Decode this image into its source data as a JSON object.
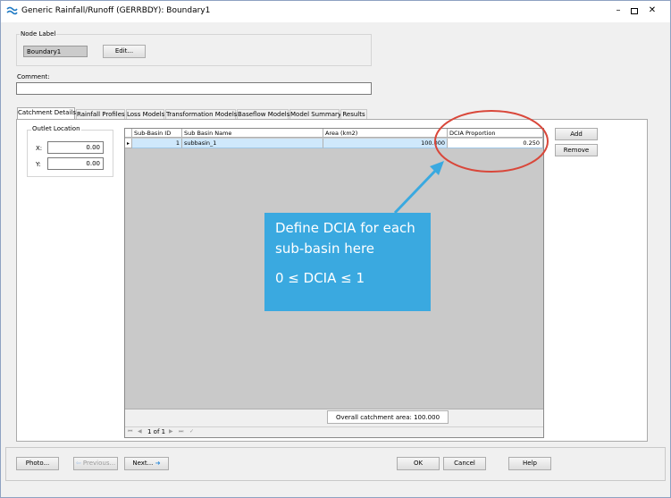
{
  "window": {
    "title": "Generic Rainfall/Runoff (GERRBDY): Boundary1",
    "controls": [
      "minimize",
      "maximize",
      "close"
    ]
  },
  "node_label": {
    "group_label": "Node Label",
    "value": "Boundary1",
    "edit_button": "Edit..."
  },
  "comment": {
    "label": "Comment:",
    "value": ""
  },
  "tabs": [
    {
      "label": "Catchment Details",
      "active": true
    },
    {
      "label": "Rainfall Profiles",
      "active": false
    },
    {
      "label": "Loss Models",
      "active": false
    },
    {
      "label": "Transformation Models",
      "active": false
    },
    {
      "label": "Baseflow Models",
      "active": false
    },
    {
      "label": "Model Summary",
      "active": false
    },
    {
      "label": "Results",
      "active": false
    }
  ],
  "outlet_location": {
    "group_label": "Outlet Location",
    "x_label": "X:",
    "x_value": "0.00",
    "y_label": "Y:",
    "y_value": "0.00"
  },
  "grid": {
    "columns": [
      "Sub-Basin ID",
      "Sub Basin Name",
      "Area (km2)",
      "DCIA Proportion"
    ],
    "rows": [
      {
        "marker": "▸",
        "id": "1",
        "name": "subbasin_1",
        "area": "100.000",
        "dcia": "0.250"
      }
    ],
    "overall_area_text": "Overall catchment area: 100.000"
  },
  "grid_buttons": {
    "add": "Add",
    "remove": "Remove"
  },
  "pager": {
    "first": "⏮",
    "prev": "◀",
    "text": "1 of 1",
    "next": "▶",
    "last": "⏭",
    "accept": "✓"
  },
  "callout": {
    "line1": "Define DCIA for each",
    "line2": "sub-basin here",
    "line3": "0 ≤ DCIA ≤ 1",
    "color": "#3aa9e0",
    "circle_color": "#d9473a"
  },
  "footer": {
    "photo": "Photo...",
    "previous": "Previous...",
    "next": "Next...",
    "ok": "OK",
    "cancel": "Cancel",
    "help": "Help"
  }
}
